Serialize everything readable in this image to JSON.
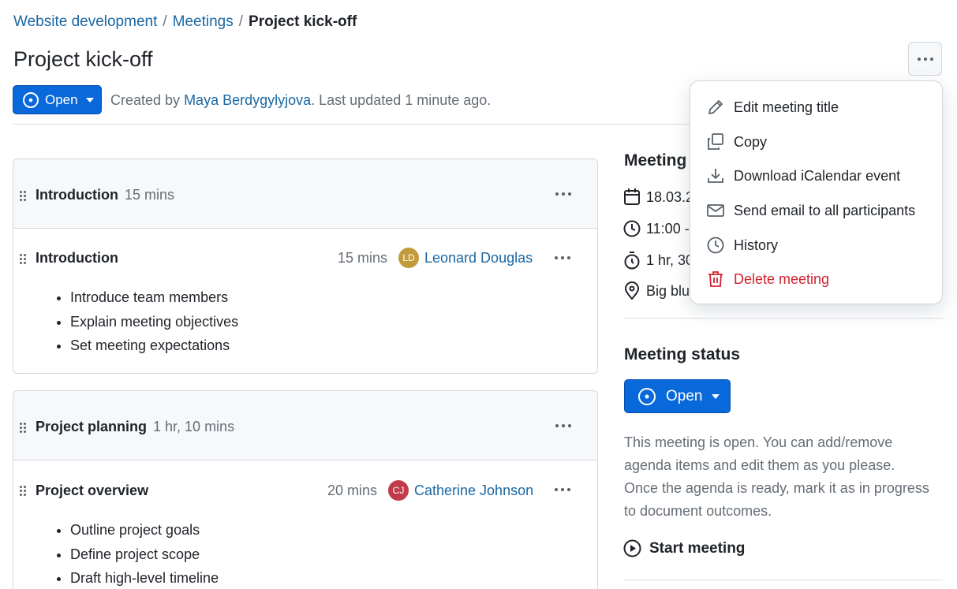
{
  "breadcrumb": {
    "items": [
      "Website development",
      "Meetings"
    ],
    "separator": "/",
    "current": "Project kick-off"
  },
  "page": {
    "title": "Project kick-off"
  },
  "header_status": {
    "label": "Open"
  },
  "meta": {
    "created_by_prefix": "Created by",
    "author": "Maya Berdygylyjova",
    "updated_text": ". Last updated 1 minute ago."
  },
  "agenda": {
    "sections": [
      {
        "title": "Introduction",
        "duration": "15 mins",
        "items": [
          {
            "title": "Introduction",
            "duration": "15 mins",
            "presenter_initials": "LD",
            "presenter": "Leonard Douglas",
            "avatar_color": "#c29b3a",
            "bullets": [
              "Introduce team members",
              "Explain meeting objectives",
              "Set meeting expectations"
            ]
          }
        ]
      },
      {
        "title": "Project planning",
        "duration": "1 hr, 10 mins",
        "items": [
          {
            "title": "Project overview",
            "duration": "20 mins",
            "presenter_initials": "CJ",
            "presenter": "Catherine Johnson",
            "avatar_color": "#c23b4b",
            "bullets": [
              "Outline project goals",
              "Define project scope",
              "Draft high-level timeline"
            ]
          }
        ]
      }
    ]
  },
  "sidebar": {
    "details_heading": "Meeting",
    "details": {
      "date": "18.03.2",
      "time": "11:00 -",
      "duration": "1 hr, 30",
      "location": "Big blu"
    },
    "status_heading": "Meeting status",
    "status_label": "Open",
    "status_description": "This meeting is open. You can add/remove agenda items and edit them as you please. Once the agenda is ready, mark it as in progress to document outcomes.",
    "start_label": "Start meeting"
  },
  "menu": {
    "items": [
      {
        "label": "Edit meeting title",
        "icon": "pencil-icon"
      },
      {
        "label": "Copy",
        "icon": "copy-icon"
      },
      {
        "label": "Download iCalendar event",
        "icon": "download-icon"
      },
      {
        "label": "Send email to all participants",
        "icon": "mail-icon"
      },
      {
        "label": "History",
        "icon": "clock-icon"
      },
      {
        "label": "Delete meeting",
        "icon": "trash-icon"
      }
    ]
  },
  "colors": {
    "primary": "#0969da",
    "link": "#1a67a3",
    "danger": "#cf222e",
    "muted": "#656d76"
  }
}
